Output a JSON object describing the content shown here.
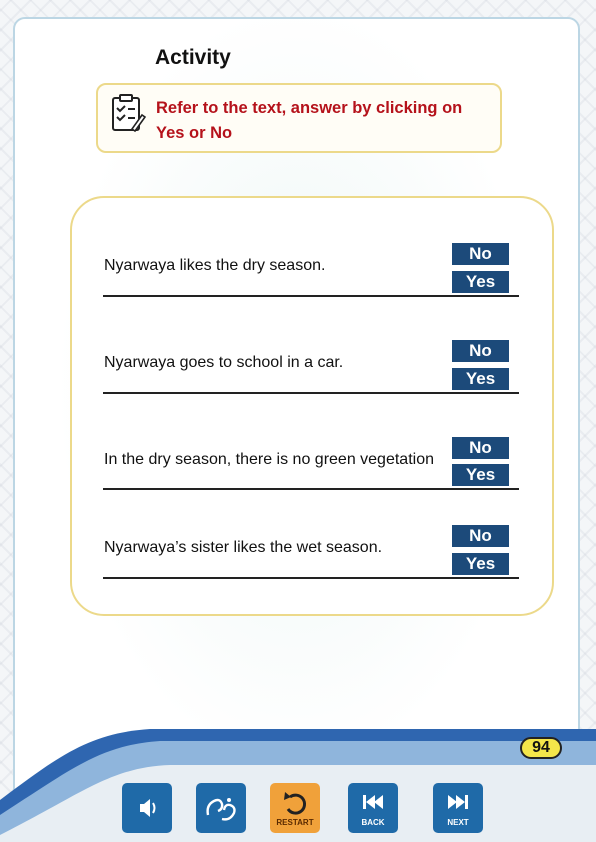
{
  "activity": {
    "title": "Activity",
    "instruction": "Refer to the text, answer by clicking on Yes or No"
  },
  "questions": [
    {
      "text": "Nyarwaya likes the dry season.",
      "no": "No",
      "yes": "Yes"
    },
    {
      "text": "Nyarwaya goes to school in a car.",
      "no": "No",
      "yes": "Yes"
    },
    {
      "text": "In the dry season, there is no green vegetation",
      "no": "No",
      "yes": "Yes"
    },
    {
      "text": "Nyarwaya’s sister likes the wet season.",
      "no": "No",
      "yes": "Yes"
    }
  ],
  "page_number": "94",
  "toolbar": {
    "audio_icon": "speaker-icon",
    "sign_icon": "sign-language-icon",
    "restart_label": "RESTART",
    "back_label": "BACK",
    "next_label": "NEXT"
  },
  "colors": {
    "button_blue": "#1c4a7a",
    "instruction_red": "#b5121b",
    "card_border": "#ecd98a",
    "restart_orange": "#f0a13a",
    "page_badge": "#f4e64a"
  }
}
